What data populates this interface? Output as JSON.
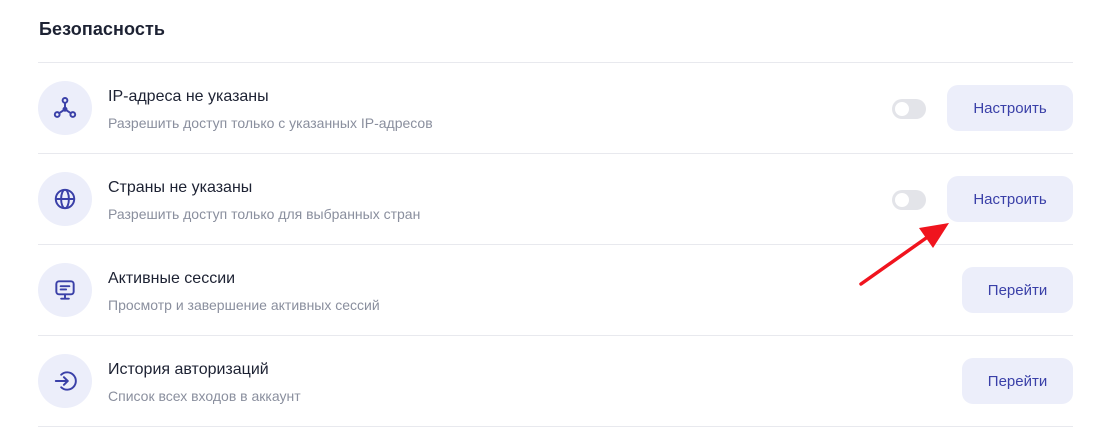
{
  "section": {
    "title": "Безопасность"
  },
  "rows": [
    {
      "title": "IP-адреса не указаны",
      "subtitle": "Разрешить доступ только с указанных IP-адресов",
      "icon": "network-nodes-icon",
      "toggle_on": false,
      "button_label": "Настроить"
    },
    {
      "title": "Страны не указаны",
      "subtitle": "Разрешить доступ только для выбранных стран",
      "icon": "globe-icon",
      "toggle_on": false,
      "button_label": "Настроить"
    },
    {
      "title": "Активные сессии",
      "subtitle": "Просмотр и завершение активных сессий",
      "icon": "monitor-icon",
      "button_label": "Перейти"
    },
    {
      "title": "История авторизаций",
      "subtitle": "Список всех входов в аккаунт",
      "icon": "login-icon",
      "button_label": "Перейти"
    }
  ],
  "colors": {
    "accent": "#3a40a8",
    "icon_bg": "#eceefa",
    "toggle_off": "#e3e4e9",
    "annotation_arrow": "#f0141e"
  }
}
